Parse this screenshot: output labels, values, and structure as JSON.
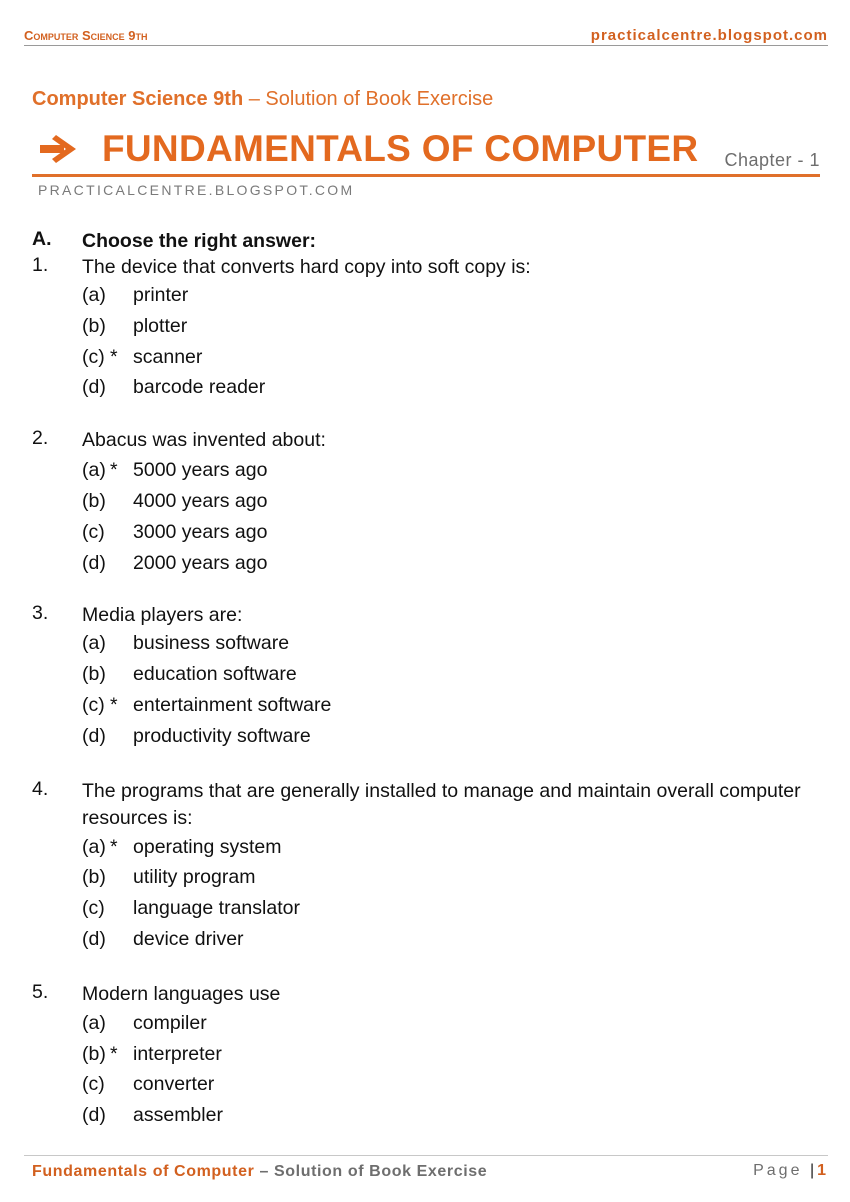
{
  "header": {
    "left": "Computer Science 9th",
    "right": "practicalcentre.blogspot.com"
  },
  "subtitle": {
    "bold": "Computer Science 9th",
    "rest": " – Solution of Book Exercise"
  },
  "title": {
    "icon": "arrow-right-icon",
    "text": "FUNDAMENTALS OF COMPUTER",
    "chapter": "Chapter - 1"
  },
  "blog_caps": "PRACTICALCENTRE.BLOGSPOT.COM",
  "section": {
    "label": "A.",
    "title": "Choose the right answer:"
  },
  "questions": [
    {
      "number": "1.",
      "text": "The device that converts hard copy into soft copy is:",
      "options": [
        {
          "label": "(a)",
          "mark": "",
          "text": "printer"
        },
        {
          "label": "(b)",
          "mark": "",
          "text": "plotter"
        },
        {
          "label": "(c)",
          "mark": "*",
          "text": "scanner"
        },
        {
          "label": "(d)",
          "mark": "",
          "text": "barcode reader"
        }
      ]
    },
    {
      "number": "2.",
      "text": "Abacus was invented about:",
      "options": [
        {
          "label": "(a)",
          "mark": "*",
          "text": "5000 years ago"
        },
        {
          "label": "(b)",
          "mark": "",
          "text": "4000 years ago"
        },
        {
          "label": "(c)",
          "mark": "",
          "text": "3000 years ago"
        },
        {
          "label": "(d)",
          "mark": "",
          "text": "2000 years ago"
        }
      ]
    },
    {
      "number": "3.",
      "text": "Media players are:",
      "options": [
        {
          "label": "(a)",
          "mark": "",
          "text": "business software"
        },
        {
          "label": "(b)",
          "mark": "",
          "text": "education software"
        },
        {
          "label": "(c)",
          "mark": "*",
          "text": "entertainment software"
        },
        {
          "label": "(d)",
          "mark": "",
          "text": "productivity software"
        }
      ]
    },
    {
      "number": "4.",
      "text": "The programs that are generally installed to manage and maintain overall computer resources is:",
      "options": [
        {
          "label": "(a)",
          "mark": "*",
          "text": "operating system"
        },
        {
          "label": "(b)",
          "mark": "",
          "text": "utility program"
        },
        {
          "label": "(c)",
          "mark": "",
          "text": "language translator"
        },
        {
          "label": "(d)",
          "mark": "",
          "text": "device driver"
        }
      ]
    },
    {
      "number": "5.",
      "text": "Modern languages use",
      "options": [
        {
          "label": "(a)",
          "mark": "",
          "text": "compiler"
        },
        {
          "label": "(b)",
          "mark": "*",
          "text": "interpreter"
        },
        {
          "label": "(c)",
          "mark": "",
          "text": "converter"
        },
        {
          "label": "(d)",
          "mark": "",
          "text": "assembler"
        }
      ]
    }
  ],
  "footer": {
    "left_orange": "Fundamentals of Computer",
    "left_gray": " – Solution of Book Exercise",
    "page_label": "Page",
    "separator": "|",
    "page_number": "1"
  },
  "colors": {
    "accent": "#e3691f",
    "gray_text": "#6e6e6e"
  }
}
